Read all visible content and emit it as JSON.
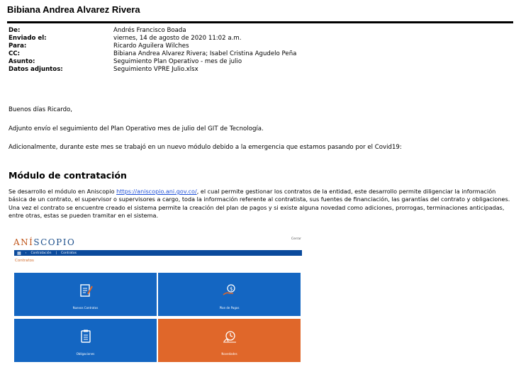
{
  "email": {
    "sender_name": "Bibiana Andrea Alvarez Rivera",
    "headers": [
      {
        "label": "De:",
        "value": "Andrés Francisco Boada"
      },
      {
        "label": "Enviado el:",
        "value": "viernes, 14 de agosto de 2020 11:02 a.m."
      },
      {
        "label": "Para:",
        "value": "Ricardo Aguilera Wilches"
      },
      {
        "label": "CC:",
        "value": "Bibiana Andrea Alvarez Rivera; Isabel Cristina Agudelo Peña"
      },
      {
        "label": "Asunto:",
        "value": "Seguimiento Plan Operativo - mes de julio"
      },
      {
        "label": "Datos adjuntos:",
        "value": "Seguimiento VPRE Julio.xlsx"
      }
    ],
    "greeting": "Buenos días Ricardo,",
    "line1": "Adjunto envío el seguimiento del Plan Operativo mes de julio del GIT de Tecnología.",
    "line2": "Adicionalmente, durante este mes se trabajó en un nuevo módulo debido a la emergencia que estamos pasando por el Covid19:",
    "section_title": "Módulo de contratación",
    "para_before_link": "Se desarrollo el módulo en Aniscopio ",
    "link": "https://aniscopio.ani.gov.co/",
    "para_after_link": ", el cual permite gestionar los contratos de la entidad, este desarrollo permite diligenciar la información básica de un contrato, el supervisor o supervisores a cargo, toda la información referente al contratista, sus fuentes de financiación, las garantías del contrato y obligaciones. Una vez el contrato se encuentre creado el sistema permite la creación del plan de pagos y si existe alguna novedad como adiciones, prorrogas, terminaciones anticipadas, entre otras, estas se pueden tramitar en el sistema."
  },
  "app": {
    "logo_prefix": "ANÍ",
    "logo_suffix": "SCOPIO",
    "user": "Cerrar",
    "nav": [
      "Contratación",
      "Contratos"
    ],
    "subtitle": "Contratos",
    "tiles": [
      {
        "label": "Nuevos Contratos",
        "icon": "document-edit-icon"
      },
      {
        "label": "Plan de Pagos",
        "icon": "money-hand-icon"
      },
      {
        "label": "Obligaciones",
        "icon": "checklist-icon"
      },
      {
        "label": "Novedades",
        "icon": "alarm-clock-icon"
      }
    ],
    "colors": {
      "blue": "#1466c2",
      "orange": "#e0672a",
      "nav": "#0a4a9c"
    }
  }
}
